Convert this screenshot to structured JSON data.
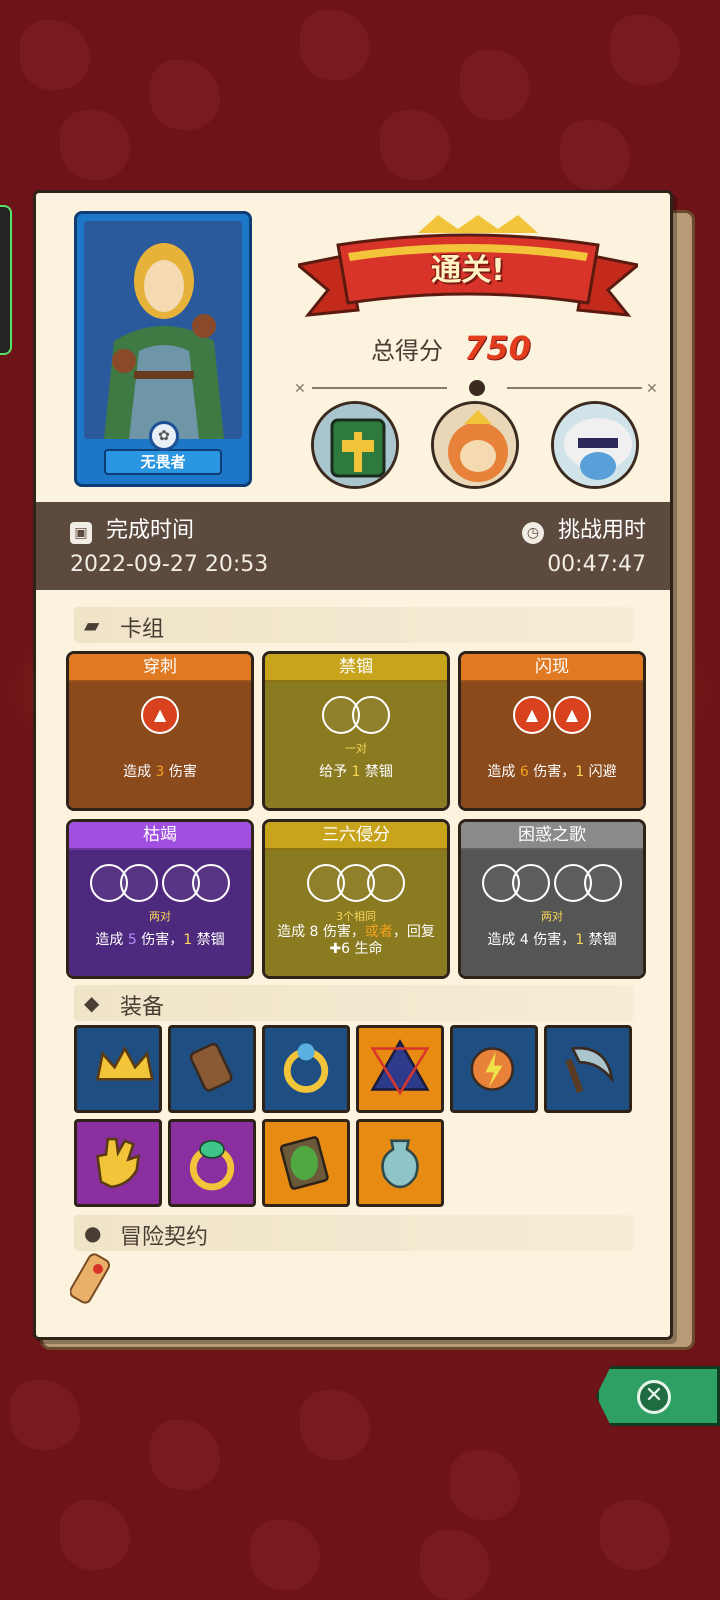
{
  "hero": {
    "name": "无畏者"
  },
  "result": {
    "banner": "通关!",
    "score_label": "总得分",
    "score_value": "750"
  },
  "bosses": [
    "boss-green-helmet",
    "boss-golden-beast",
    "boss-furry-mage"
  ],
  "time": {
    "finish_label": "完成时间",
    "finish_value": "2022-09-27 20:53",
    "duration_label": "挑战用时",
    "duration_value": "00:47:47"
  },
  "sections": {
    "deck": "卡组",
    "equipment": "装备",
    "contract": "冒险契约"
  },
  "cards": [
    {
      "title": "穿刺",
      "color": "#e07a22",
      "body": "#8a4a1c",
      "sub": "",
      "desc_prefix": "造成 ",
      "desc_a": "3",
      "desc_mid": " 伤害",
      "desc_b": "",
      "desc_end": ""
    },
    {
      "title": "禁锢",
      "color": "#c7a41c",
      "body": "#8a7a20",
      "sub": "一对",
      "desc_prefix": "给予 ",
      "desc_a": "1",
      "desc_mid": " 禁锢",
      "desc_b": "",
      "desc_end": ""
    },
    {
      "title": "闪现",
      "color": "#e07a22",
      "body": "#8a4a1c",
      "sub": "",
      "desc_prefix": "造成 ",
      "desc_a": "6",
      "desc_mid": " 伤害，",
      "desc_b": "1",
      "desc_end": " 闪避"
    },
    {
      "title": "枯竭",
      "color": "#a04fe0",
      "body": "#4e2a7e",
      "sub": "两对",
      "desc_prefix": "造成 ",
      "desc_a": "5",
      "desc_mid": " 伤害，",
      "desc_b": "1",
      "desc_end": " 禁锢"
    },
    {
      "title": "三六侵分",
      "color": "#c7a41c",
      "body": "#8a7a20",
      "sub": "3个相同",
      "desc_prefix": "造成 ",
      "desc_a": "8",
      "desc_mid": " 伤害，",
      "desc_b": "或者",
      "desc_end": "，回复 ✚6 生命"
    },
    {
      "title": "困惑之歌",
      "color": "#8a8a8a",
      "body": "#555555",
      "sub": "两对",
      "desc_prefix": "造成 ",
      "desc_a": "4",
      "desc_mid": " 伤害，",
      "desc_b": "1",
      "desc_end": " 禁锢"
    }
  ],
  "equipment": [
    {
      "name": "crown-icon",
      "bg": "#1f4f82"
    },
    {
      "name": "bracer-icon",
      "bg": "#1f4f82"
    },
    {
      "name": "ring-icon",
      "bg": "#1f4f82"
    },
    {
      "name": "triangle-amulet-icon",
      "bg": "#e88b12"
    },
    {
      "name": "lightning-orb-icon",
      "bg": "#1f4f82"
    },
    {
      "name": "scythe-icon",
      "bg": "#1f4f82"
    },
    {
      "name": "glove-icon",
      "bg": "#8a2ea0"
    },
    {
      "name": "gem-ring-icon",
      "bg": "#8a2ea0"
    },
    {
      "name": "moss-tablet-icon",
      "bg": "#e88b12"
    },
    {
      "name": "vase-icon",
      "bg": "#e88b12"
    }
  ]
}
